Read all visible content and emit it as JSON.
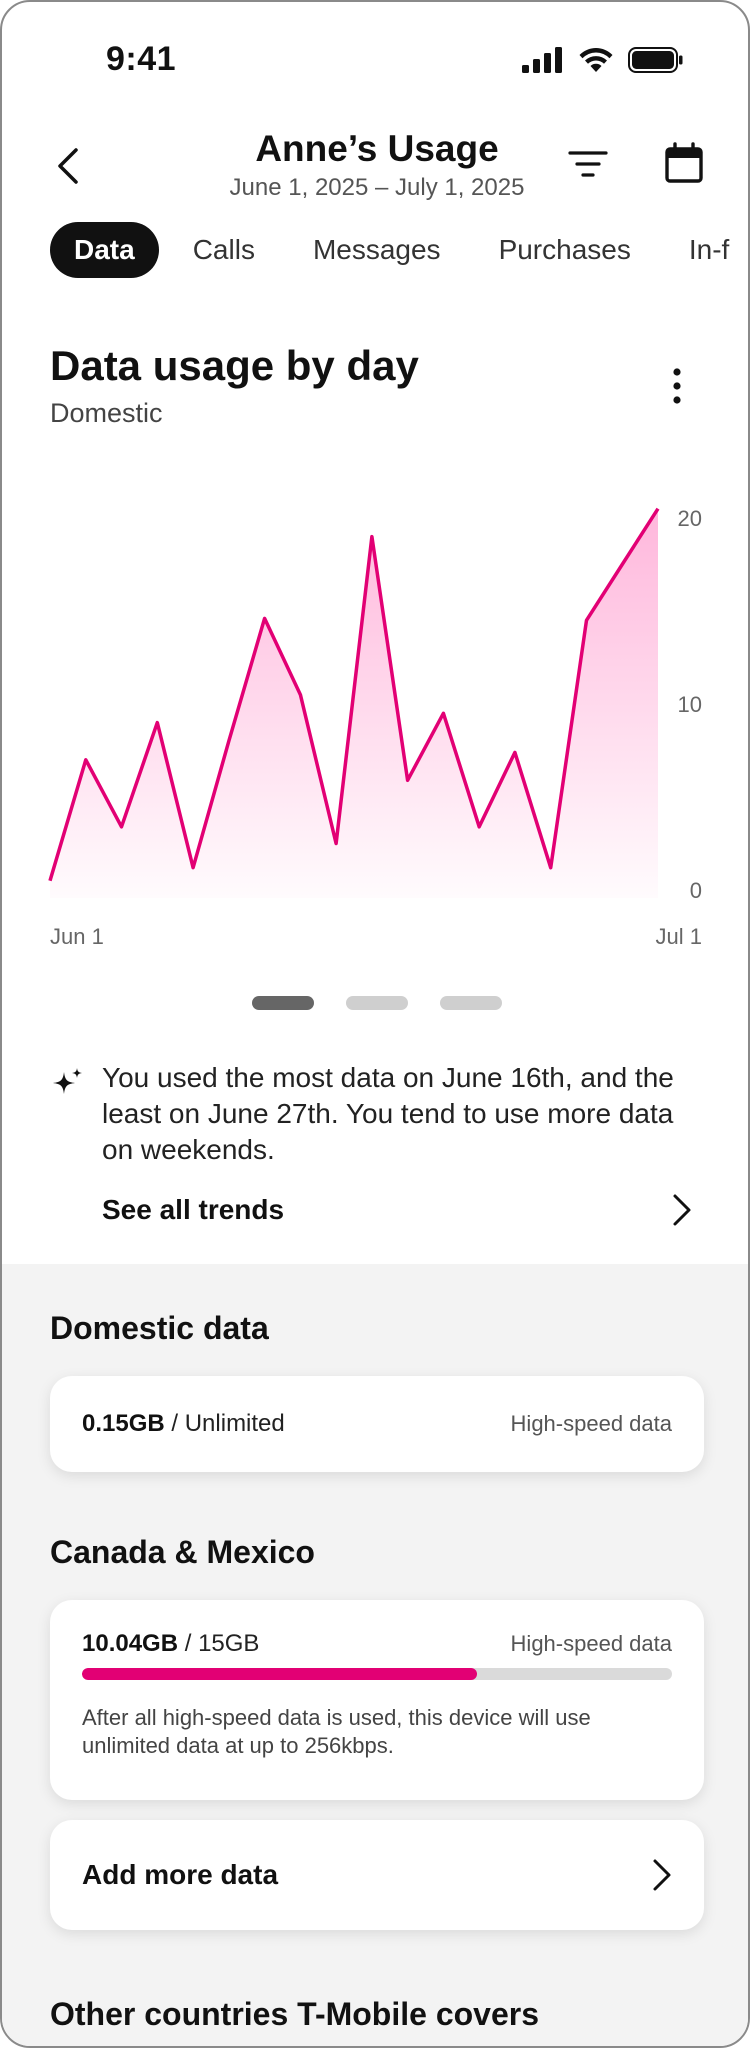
{
  "status_bar": {
    "time": "9:41"
  },
  "header": {
    "title": "Anne’s Usage",
    "subtitle": "June 1, 2025 – July 1, 2025"
  },
  "tabs": [
    {
      "label": "Data",
      "active": true
    },
    {
      "label": "Calls",
      "active": false
    },
    {
      "label": "Messages",
      "active": false
    },
    {
      "label": "Purchases",
      "active": false
    },
    {
      "label": "In-f",
      "active": false
    }
  ],
  "chart_card": {
    "title": "Data usage by day",
    "subtitle": "Domestic"
  },
  "chart_data": {
    "type": "area",
    "x_start_label": "Jun 1",
    "x_end_label": "Jul 1",
    "values": [
      0.5,
      7,
      3.4,
      9,
      1.2,
      8,
      14.6,
      10.5,
      2.5,
      19,
      5.9,
      9.5,
      3.4,
      7.4,
      1.2,
      14.5,
      17.5,
      20.5
    ],
    "ylim": [
      0,
      20
    ],
    "yticks": [
      "0",
      "10",
      "20"
    ],
    "line_color": "#e20074",
    "fill_color": "#ff9fd0"
  },
  "pager": {
    "count": 3,
    "active_index": 0
  },
  "insight": {
    "text": "You used the most data on June 16th, and the least on June 27th. You tend to use more data on weekends.",
    "link_label": "See all trends"
  },
  "domestic": {
    "section_title": "Domestic data",
    "amount": "0.15GB",
    "limit": " / Unlimited",
    "note": "High-speed data"
  },
  "canada_mexico": {
    "section_title": "Canada & Mexico",
    "amount": "10.04GB",
    "limit": " / 15GB",
    "note": "High-speed data",
    "progress_fraction": 0.669,
    "description": "After all high-speed data is used, this device will use unlimited data at up to 256kbps."
  },
  "add_data": {
    "label": "Add more data"
  },
  "other_countries": {
    "section_title": "Other countries T-Mobile covers"
  },
  "colors": {
    "accent": "#e20074",
    "background_grey": "#f3f3f3"
  }
}
